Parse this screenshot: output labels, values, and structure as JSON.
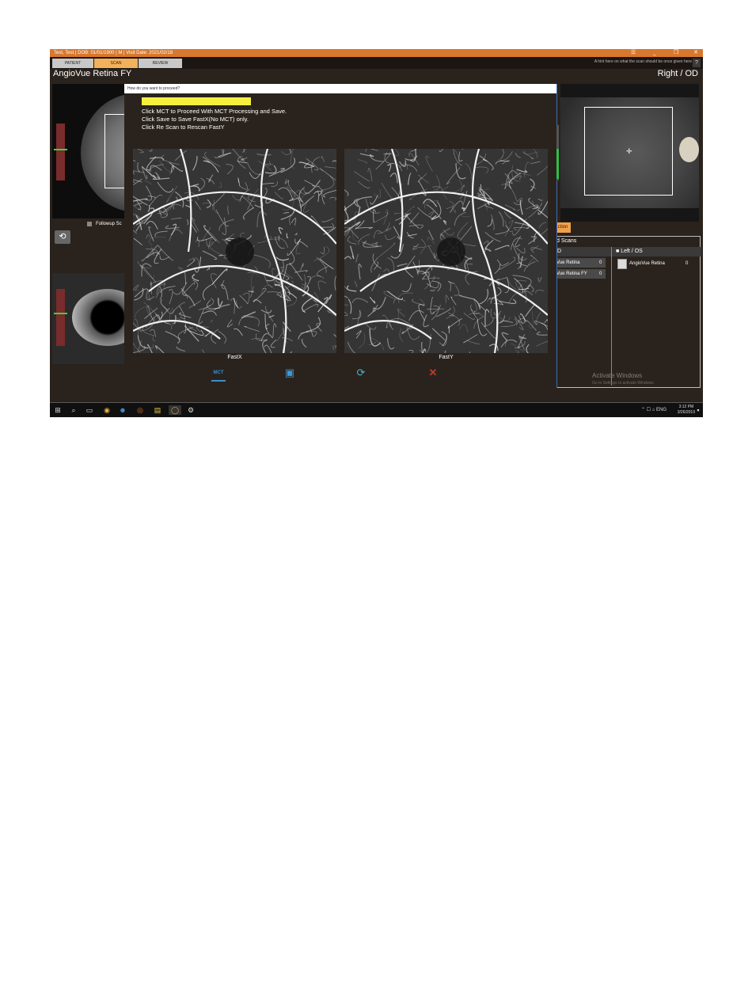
{
  "window": {
    "title_info": "Test, Test  |  DOB: 01/01/1900  |  M  |  Visit Date: 2021/02/18",
    "minimize": "_",
    "restore": "❐",
    "close": "✕",
    "menu_icon": "hamburger-icon"
  },
  "tabs": [
    {
      "label": "PATIENT"
    },
    {
      "label": "SCAN"
    },
    {
      "label": "REVIEW"
    }
  ],
  "header_hint": "A hint here on what the scan should be once given here",
  "help": "?",
  "app_title": "AngioVue Retina FY",
  "eye_side": "Right / OD",
  "followup_label": "Followup Sc",
  "dialog": {
    "title": "How do you want to proceed?",
    "highlight": "",
    "instructions": [
      "Click MCT to Proceed With MCT Processing and Save.",
      "Click Save to Save FastX(No MCT) only.",
      "Click Re Scan to Rescan FastY"
    ],
    "images": [
      {
        "caption": "FastX"
      },
      {
        "caption": "FastY"
      }
    ],
    "buttons": [
      {
        "name": "mct",
        "glyph": "MCT"
      },
      {
        "name": "save",
        "glyph": "💾"
      },
      {
        "name": "rescan",
        "glyph": "⟳"
      },
      {
        "name": "cancel",
        "glyph": "✕"
      }
    ]
  },
  "action_label": "ction",
  "scans": {
    "header": "d Scans",
    "right_col": "D",
    "left_col": "Left / OS",
    "right_rows": [
      {
        "name": "Vue Retina",
        "count": "0"
      },
      {
        "name": "Vue Retina FY",
        "count": "0"
      }
    ],
    "left_rows": [
      {
        "name": "AngioVue Retina",
        "count": "0"
      }
    ]
  },
  "activate": {
    "line1": "Activate Windows",
    "line2": "Go to Settings to activate Windows."
  },
  "taskbar": {
    "time": "3:12 PM",
    "date": "3/26/2019",
    "tray": "⌃ ☐ ⌂ ENG"
  },
  "colors": {
    "titlebar": "#d7782e",
    "highlight": "#f6ef3e",
    "action": "#f0a04a",
    "save_icon": "#3a9ad9",
    "cancel_icon": "#c0392b"
  }
}
